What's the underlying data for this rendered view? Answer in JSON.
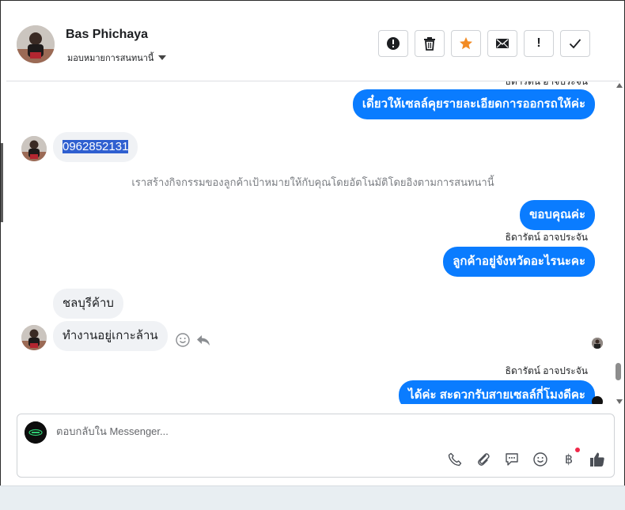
{
  "header": {
    "name": "Bas Phichaya",
    "assign_label": "มอบหมายการสนทนานี้",
    "actions": [
      {
        "name": "report-spam-button",
        "icon": "alert-circle-icon"
      },
      {
        "name": "delete-button",
        "icon": "trash-icon"
      },
      {
        "name": "star-button",
        "icon": "star-icon"
      },
      {
        "name": "mark-unread-button",
        "icon": "envelope-icon"
      },
      {
        "name": "follow-up-button",
        "icon": "exclamation-icon",
        "glyph": "!"
      },
      {
        "name": "done-button",
        "icon": "check-icon"
      }
    ]
  },
  "chat": {
    "top_partial_sender": "ธิดารัตน์ อาจประจัน",
    "msg_out_1": "เดี๋ยวให้เซลล์คุยรายละเอียดการออกรถให้ค่ะ",
    "msg_in_phone": "0962852131",
    "system_note": "เราสร้างกิจกรรมของลูกค้าเป้าหมายให้กับคุณโดยอัตโนมัติโดยอิงตามการสนทนานี้",
    "msg_out_2": "ขอบคุณค่ะ",
    "sender_2": "ธิดารัตน์ อาจประจัน",
    "msg_out_3": "ลูกค้าอยู่จังหวัดอะไรนะคะ",
    "msg_in_2": "ชลบุรีค้าบ",
    "msg_in_3": "ทำงานอยู่เกาะล้าน",
    "sender_3": "ธิดารัตน์ อาจประจัน",
    "msg_out_4": "ได้ค่ะ สะดวกรับสายเซลล์กี่โมงดีคะ"
  },
  "composer": {
    "placeholder": "ตอบกลับใน Messenger...",
    "tools": [
      "phone-icon",
      "paperclip-icon",
      "chat-bubble-icon",
      "smiley-icon",
      "baht-icon",
      "thumbs-up-icon"
    ],
    "baht_glyph": "฿"
  },
  "colors": {
    "accent": "#0a7cff",
    "star": "#f28b24",
    "selection": "#2f5fd0",
    "notification_dot": "#f02849"
  }
}
